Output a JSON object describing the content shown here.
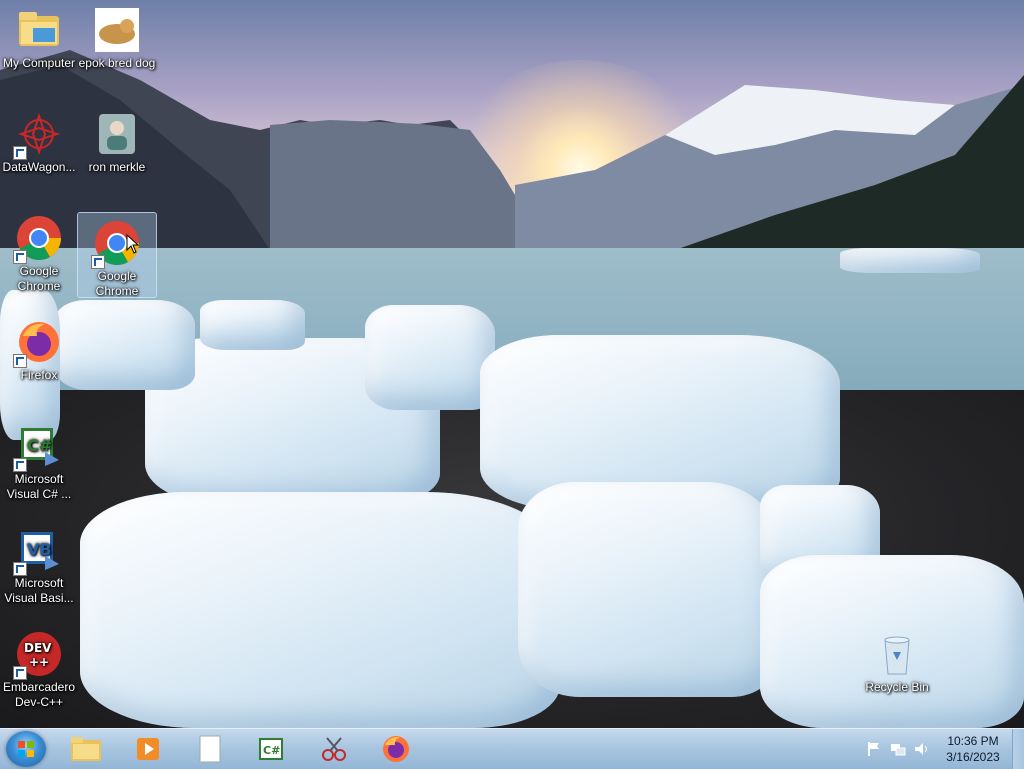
{
  "desktop": {
    "icons": [
      {
        "label": "My Computer"
      },
      {
        "label": "epok bred dog"
      },
      {
        "label": "DataWagon..."
      },
      {
        "label": "ron merkle"
      },
      {
        "label": "Google Chrome"
      },
      {
        "label": "Google Chrome"
      },
      {
        "label": "Firefox"
      },
      {
        "label": "Microsoft Visual C# ..."
      },
      {
        "label": "Microsoft Visual Basi..."
      },
      {
        "label": "Embarcadero Dev-C++"
      },
      {
        "label": "Recycle Bin"
      }
    ]
  },
  "taskbar": {
    "pinned": [
      "folder-icon",
      "media-player-icon",
      "notepad-icon",
      "csharp-icon",
      "snipping-tool-icon",
      "firefox-icon"
    ],
    "clock": {
      "time": "10:36 PM",
      "date": "3/16/2023"
    }
  },
  "colors": {
    "taskbar": "#aac6e0",
    "start_orb": "#3c8fd6"
  }
}
